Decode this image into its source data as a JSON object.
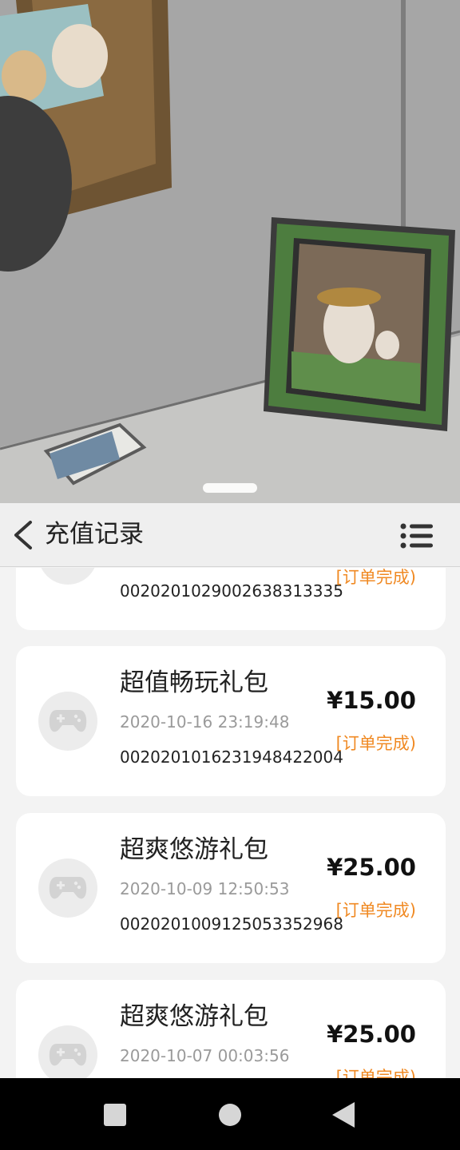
{
  "header": {
    "title": "充值记录"
  },
  "records": [
    {
      "name": "",
      "time": "",
      "price": "",
      "order": "0020201029002638313335",
      "status": "[订单完成)"
    },
    {
      "name": "超值畅玩礼包",
      "time": "2020-10-16 23:19:48",
      "price": "¥15.00",
      "order": "0020201016231948422004",
      "status": "[订单完成)"
    },
    {
      "name": "超爽悠游礼包",
      "time": "2020-10-09 12:50:53",
      "price": "¥25.00",
      "order": "0020201009125053352968",
      "status": "[订单完成)"
    },
    {
      "name": "超爽悠游礼包",
      "time": "2020-10-07 00:03:56",
      "price": "¥25.00",
      "order": "",
      "status": "[订单完成)"
    }
  ],
  "colors": {
    "status": "#f08a24",
    "panel_bg": "#f3f3f3",
    "card_bg": "#ffffff"
  },
  "icons": {
    "back": "chevron-left-icon",
    "menu": "list-menu-icon",
    "avatar": "gamepad-icon"
  }
}
